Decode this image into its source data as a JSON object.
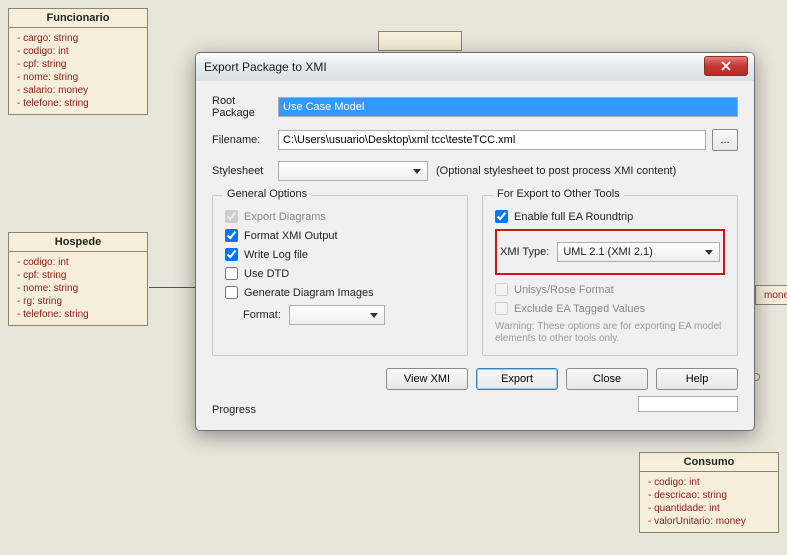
{
  "uml": {
    "funcionario": {
      "title": "Funcionario",
      "attrs": [
        "cargo: string",
        "codigo: int",
        "cpf: string",
        "nome: string",
        "salario: money",
        "telefone: string"
      ]
    },
    "hospede": {
      "title": "Hospede",
      "attrs": [
        "codigo: int",
        "cpf: string",
        "nome: string",
        "rg: string",
        "telefone: string"
      ]
    },
    "consumo": {
      "title": "Consumo",
      "attrs": [
        "codigo: int",
        "descricao: string",
        "quantidade: int",
        "valorUnitario: money"
      ]
    },
    "edge_fragment": "money",
    "edge_circle": "o"
  },
  "dialog": {
    "title": "Export Package to XMI",
    "root_label": "Root Package",
    "root_value": "Use Case Model",
    "filename_label": "Filename:",
    "filename_value": "C:\\Users\\usuario\\Desktop\\xml tcc\\testeTCC.xml",
    "browse": "...",
    "stylesheet_label": "Stylesheet",
    "stylesheet_note": "(Optional stylesheet to post process XMI content)",
    "general": {
      "legend": "General Options",
      "export_diagrams": "Export Diagrams",
      "format_xmi": "Format XMI Output",
      "write_log": "Write Log file",
      "use_dtd": "Use DTD",
      "gen_images": "Generate Diagram Images",
      "format_label": "Format:"
    },
    "export_other": {
      "legend": "For Export to Other Tools",
      "enable_roundtrip": "Enable full EA Roundtrip",
      "xmi_type_label": "XMI Type:",
      "xmi_type_value": "UML 2.1 (XMI 2.1)",
      "unisys": "Unisys/Rose Format",
      "exclude_tagged": "Exclude EA Tagged Values",
      "warning": "Warning: These options are for exporting EA model elements to other tools only."
    },
    "buttons": {
      "view": "View XMI",
      "export": "Export",
      "close": "Close",
      "help": "Help"
    },
    "progress": "Progress"
  }
}
